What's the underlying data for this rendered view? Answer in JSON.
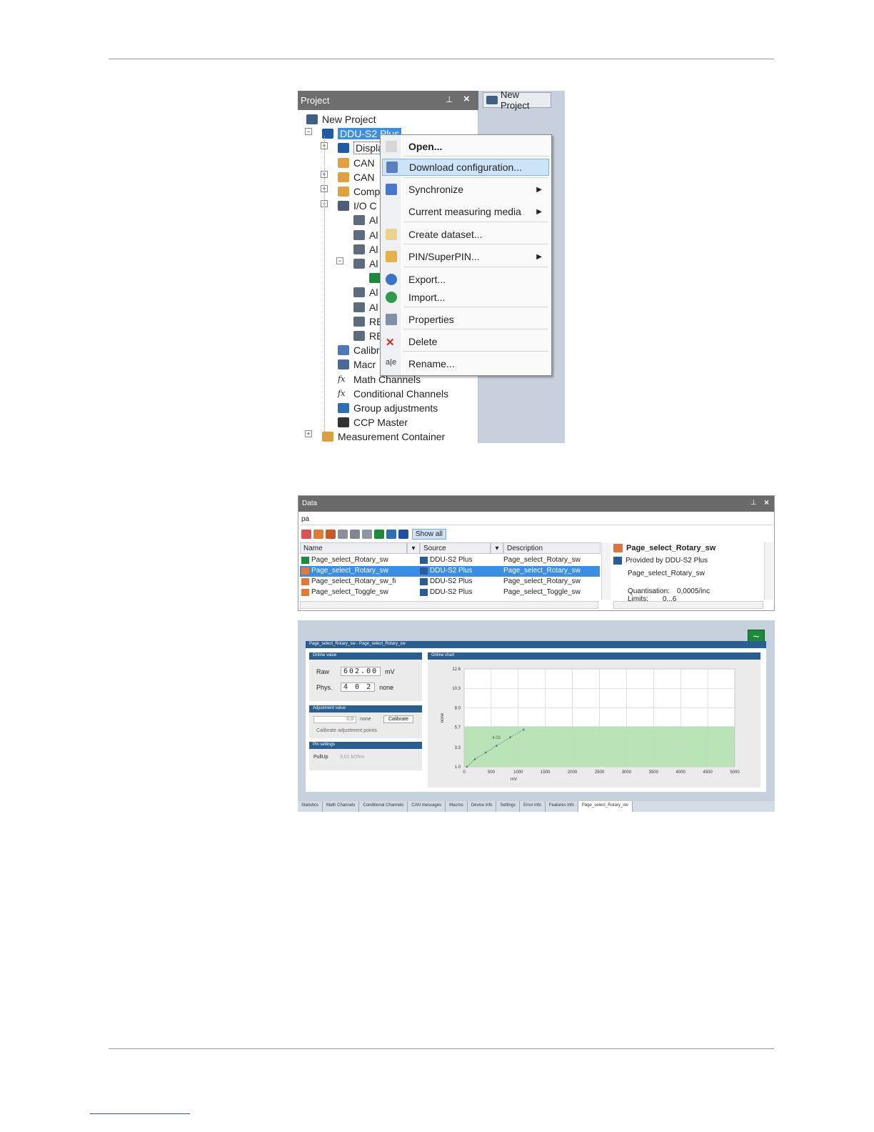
{
  "project": {
    "title": "Project",
    "doc_tab": "New Project",
    "tree": [
      {
        "label": "New Project",
        "icon": "project-icon"
      },
      {
        "label": "DDU-S2 Plus",
        "icon": "device-icon"
      },
      {
        "label": "Displa",
        "icon": "display-icon"
      },
      {
        "label": "CAN",
        "icon": "folder-icon"
      },
      {
        "label": "CAN",
        "icon": "folder-icon"
      },
      {
        "label": "Comp",
        "icon": "folder-icon"
      },
      {
        "label": "I/O C",
        "icon": "io-icon"
      },
      {
        "label": "Al",
        "icon": "analog-input-icon"
      },
      {
        "label": "Al",
        "icon": "analog-input-icon"
      },
      {
        "label": "Al",
        "icon": "analog-input-icon"
      },
      {
        "label": "Al",
        "icon": "analog-input-icon"
      },
      {
        "label": "",
        "icon": "signal-chart-icon"
      },
      {
        "label": "Al",
        "icon": "analog-input-icon"
      },
      {
        "label": "Al",
        "icon": "analog-input-icon"
      },
      {
        "label": "RE",
        "icon": "analog-input-icon"
      },
      {
        "label": "RE",
        "icon": "analog-input-icon"
      },
      {
        "label": "Calibr",
        "icon": "calibration-icon"
      },
      {
        "label": "Macr",
        "icon": "macro-icon"
      },
      {
        "label": "Math Channels",
        "icon": "fx-icon"
      },
      {
        "label": "Conditional Channels",
        "icon": "fx-icon"
      },
      {
        "label": "Group adjustments",
        "icon": "wrench-icon"
      },
      {
        "label": "CCP Master",
        "icon": "ccp-icon"
      },
      {
        "label": "Measurement Container",
        "icon": "container-icon"
      }
    ],
    "context_menu": [
      {
        "label": "Open...",
        "icon": "open-icon",
        "bold": true
      },
      {
        "label": "Download configuration...",
        "icon": "download-icon",
        "highlighted": true
      },
      {
        "label": "Synchronize",
        "icon": "sync-icon",
        "submenu": true
      },
      {
        "label": "Current measuring media",
        "icon": "",
        "submenu": true
      },
      {
        "label": "Create dataset...",
        "icon": "dataset-icon"
      },
      {
        "label": "PIN/SuperPIN...",
        "icon": "key-icon",
        "submenu": true
      },
      {
        "label": "Export...",
        "icon": "export-icon"
      },
      {
        "label": "Import...",
        "icon": "import-icon"
      },
      {
        "label": "Properties",
        "icon": "properties-icon"
      },
      {
        "label": "Delete",
        "icon": "delete-icon"
      },
      {
        "label": "Rename...",
        "icon": "rename-icon"
      }
    ]
  },
  "data_panel": {
    "title": "Data",
    "filter": "pa",
    "show_all": "Show all",
    "columns": [
      "Name",
      "Source",
      "Description"
    ],
    "rows": [
      {
        "name": "Page_select_Rotary_sw",
        "source": "DDU-S2 Plus",
        "description": "Page_select_Rotary_sw"
      },
      {
        "name": "Page_select_Rotary_sw",
        "source": "DDU-S2 Plus",
        "description": "Page_select_Rotary_sw",
        "selected": true
      },
      {
        "name": "Page_select_Rotary_sw_fi",
        "source": "DDU-S2 Plus",
        "description": "Page_select_Rotary_sw"
      },
      {
        "name": "Page_select_Toggle_sw",
        "source": "DDU-S2 Plus",
        "description": "Page_select_Toggle_sw"
      }
    ],
    "info": {
      "title": "Page_select_Rotary_sw",
      "provided_by": "Provided by DDU-S2 Plus",
      "desc": "Page_select_Rotary_sw",
      "quantisation_label": "Quantisation:",
      "quantisation_value": "0,0005/inc",
      "limits_label": "Limits:",
      "limits_value": "0...6"
    }
  },
  "online": {
    "title": "Page_select_Rotary_sw - Page_select_Rotary_sw",
    "online_value": "Online value",
    "raw_label": "Raw",
    "raw_value": "602.00",
    "raw_unit": "mV",
    "phys_label": "Phys.",
    "phys_value": "4 0 2",
    "phys_unit": "none",
    "adjust_title": "Adjustment value",
    "adjust_value": "0,0",
    "adjust_unit": "none",
    "calibrate": "Calibrate",
    "calibrate_points": "Calibrate adjustment points",
    "pin_title": "Pin settings",
    "pullup_label": "PullUp",
    "pullup_value": "3,01 kOhm",
    "chart_title": "Online chart",
    "tabs": [
      "Statistics",
      "Math Channels",
      "Conditional Channels",
      "CAN messages",
      "Macros",
      "Device info",
      "Settings",
      "Error info",
      "Features info",
      "Page_select_Rotary_sw"
    ]
  },
  "chart_data": {
    "type": "line",
    "title": "Online chart",
    "xlabel": "mV",
    "ylabel": "none",
    "xlim": [
      0,
      5000
    ],
    "ylim": [
      1.0,
      12.6
    ],
    "xticks": [
      0,
      500,
      1000,
      1500,
      2000,
      2500,
      3000,
      3500,
      4000,
      4500,
      5000
    ],
    "yticks": [
      "1.0",
      "3.3",
      "5.7",
      "8.0",
      "10.3",
      "12.6"
    ],
    "series": [
      {
        "x": [
          50,
          200,
          400,
          600,
          850,
          1100
        ],
        "y": [
          1.0,
          1.9,
          2.7,
          3.5,
          4.5,
          5.4
        ]
      }
    ],
    "annotation": "4.02",
    "band": {
      "from": 1.0,
      "to": 5.8,
      "color": "#b8e4b8"
    },
    "grid": true
  }
}
